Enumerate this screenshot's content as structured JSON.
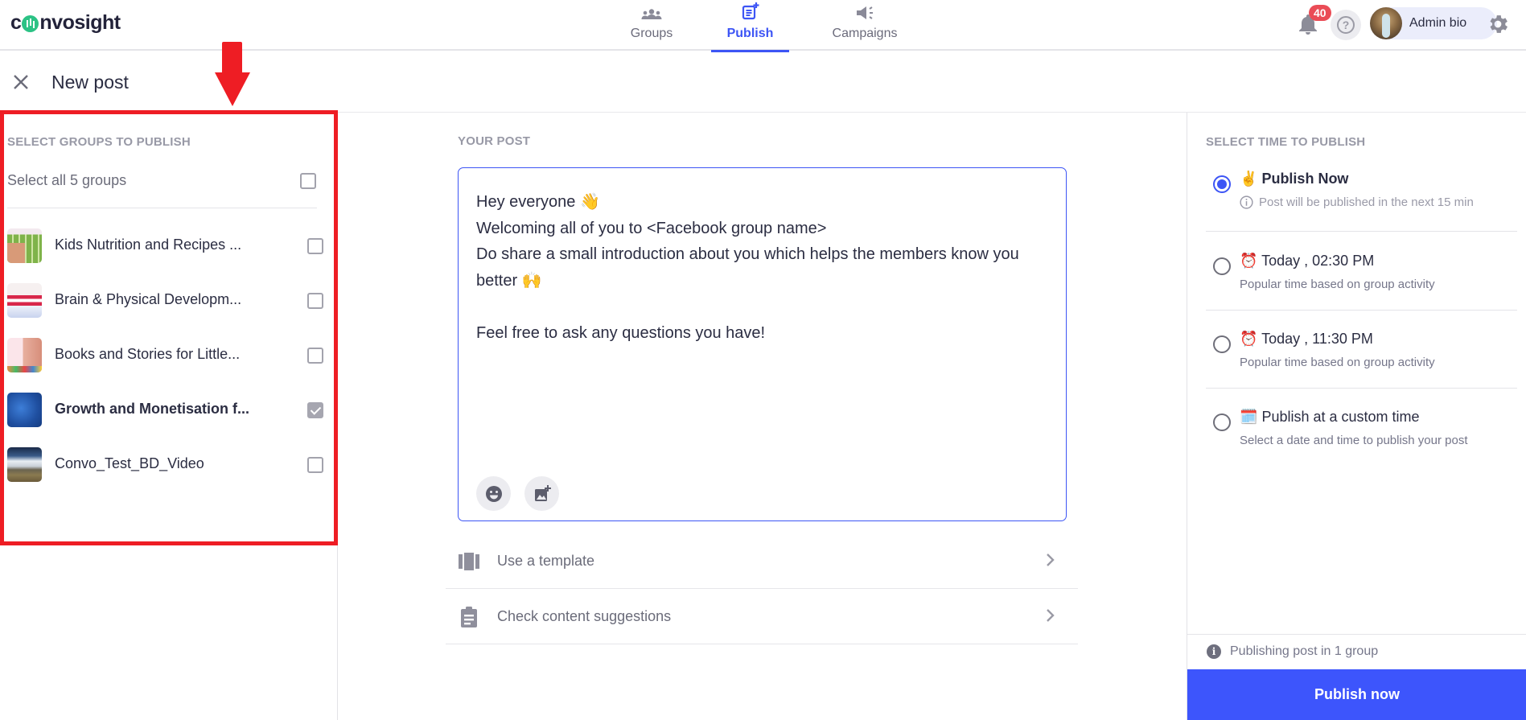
{
  "header": {
    "logo_text_before": "c",
    "logo_text_after": "nvosight",
    "nav": [
      {
        "label": "Groups",
        "icon": "groups-icon",
        "active": false
      },
      {
        "label": "Publish",
        "icon": "publish-icon",
        "active": true
      },
      {
        "label": "Campaigns",
        "icon": "megaphone-icon",
        "active": false
      }
    ],
    "notification_count": "40",
    "help_symbol": "?",
    "profile_name": "Admin bio",
    "accent_color": "#3d55f5"
  },
  "page": {
    "title": "New post"
  },
  "groups_panel": {
    "section_label": "SELECT GROUPS TO PUBLISH",
    "select_all_label": "Select all 5 groups",
    "select_all_checked": false,
    "groups": [
      {
        "name": "Kids Nutrition and Recipes ...",
        "checked": false
      },
      {
        "name": "Brain & Physical Developm...",
        "checked": false
      },
      {
        "name": "Books and Stories for Little...",
        "checked": false
      },
      {
        "name": "Growth and Monetisation f...",
        "checked": true
      },
      {
        "name": "Convo_Test_BD_Video",
        "checked": false
      }
    ]
  },
  "post": {
    "section_label": "YOUR POST",
    "text": "Hey everyone 👋\nWelcoming all of you to <Facebook group name>\nDo share a small introduction about you which helps the members know you better 🙌\n\nFeel free to ask any questions you have!",
    "actions": [
      {
        "label": "Use a template",
        "icon": "template-icon"
      },
      {
        "label": "Check content suggestions",
        "icon": "clipboard-icon"
      }
    ]
  },
  "schedule": {
    "section_label": "SELECT TIME TO PUBLISH",
    "options": [
      {
        "emoji": "✌️",
        "title": "Publish Now",
        "subtitle": "Post will be published in the next 15 min",
        "selected": true
      },
      {
        "emoji": "⏰",
        "title": "Today , 02:30 PM",
        "subtitle": "Popular time based on group activity",
        "selected": false
      },
      {
        "emoji": "⏰",
        "title": "Today , 11:30 PM",
        "subtitle": "Popular time based on group activity",
        "selected": false
      },
      {
        "emoji": "🗓️",
        "title": "Publish at a custom time",
        "subtitle": "Select a date and time to publish your post",
        "selected": false
      }
    ],
    "footer_info": "Publishing post in 1 group",
    "publish_button": "Publish now"
  }
}
